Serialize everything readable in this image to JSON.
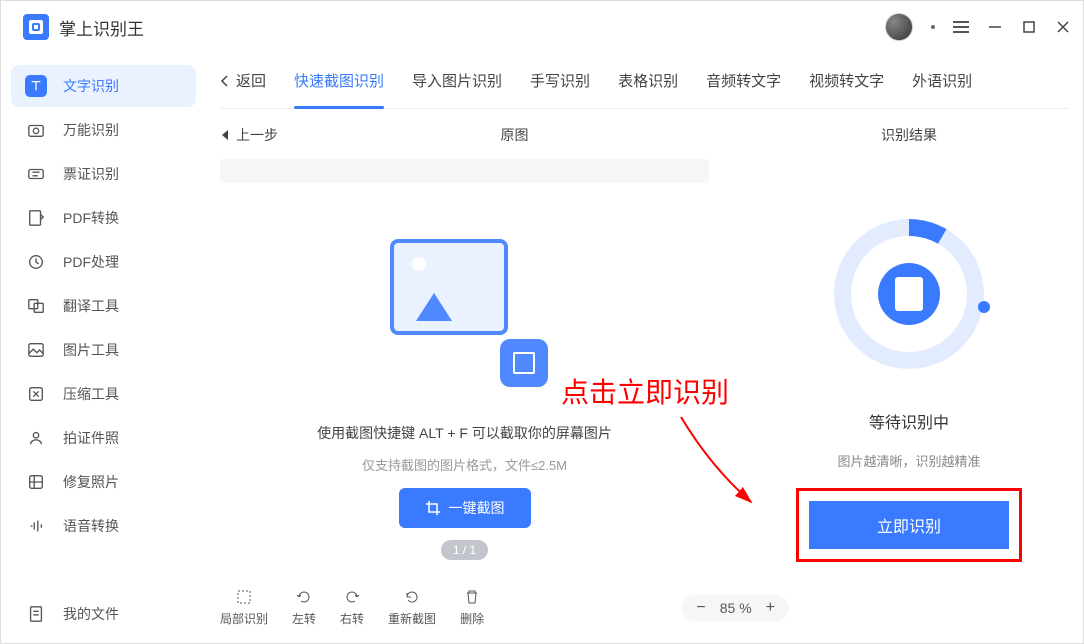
{
  "app": {
    "title": "掌上识别王"
  },
  "sidebar": {
    "items": [
      {
        "label": "文字识别"
      },
      {
        "label": "万能识别"
      },
      {
        "label": "票证识别"
      },
      {
        "label": "PDF转换"
      },
      {
        "label": "PDF处理"
      },
      {
        "label": "翻译工具"
      },
      {
        "label": "图片工具"
      },
      {
        "label": "压缩工具"
      },
      {
        "label": "拍证件照"
      },
      {
        "label": "修复照片"
      },
      {
        "label": "语音转换"
      }
    ],
    "footer": {
      "label": "我的文件"
    }
  },
  "tabs": {
    "back": "返回",
    "items": [
      {
        "label": "快速截图识别"
      },
      {
        "label": "导入图片识别"
      },
      {
        "label": "手写识别"
      },
      {
        "label": "表格识别"
      },
      {
        "label": "音频转文字"
      },
      {
        "label": "视频转文字"
      },
      {
        "label": "外语识别"
      }
    ]
  },
  "subhead": {
    "prev": "上一步",
    "left": "原图",
    "right": "识别结果"
  },
  "left": {
    "hint1": "使用截图快捷键 ALT + F 可以截取你的屏幕图片",
    "hint2": "仅支持截图的图片格式，文件≤2.5M",
    "capture": "一键截图",
    "pager": "1 / 1"
  },
  "right": {
    "wait": "等待识别中",
    "hint": "图片越清晰，识别越精准",
    "button": "立即识别"
  },
  "toolbar": {
    "items": [
      {
        "label": "局部识别"
      },
      {
        "label": "左转"
      },
      {
        "label": "右转"
      },
      {
        "label": "重新截图"
      },
      {
        "label": "删除"
      }
    ],
    "zoom": {
      "value": "85 %"
    }
  },
  "annotation": {
    "text": "点击立即识别"
  }
}
